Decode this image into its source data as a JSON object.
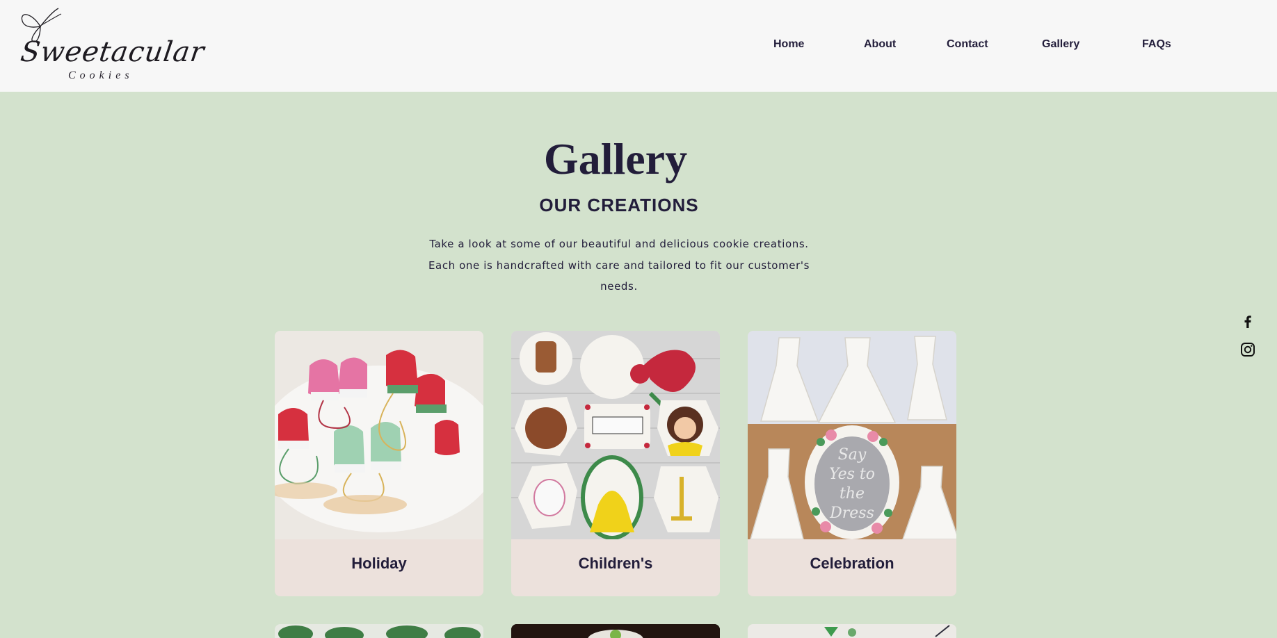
{
  "brand": {
    "name": "Sweetacular",
    "tagline": "Cookies"
  },
  "nav": {
    "items": [
      {
        "label": "Home"
      },
      {
        "label": "About"
      },
      {
        "label": "Contact"
      },
      {
        "label": "Gallery"
      },
      {
        "label": "FAQs"
      }
    ]
  },
  "hero": {
    "title": "Gallery",
    "subtitle": "OUR CREATIONS",
    "intro": "Take a look at some of our beautiful and delicious cookie creations. Each one is handcrafted with care and tailored to fit our customer's needs."
  },
  "social": [
    {
      "icon": "facebook-icon"
    },
    {
      "icon": "instagram-icon"
    }
  ],
  "gallery": {
    "cards": [
      {
        "label": "Holiday"
      },
      {
        "label": "Children's"
      },
      {
        "label": "Celebration"
      }
    ]
  },
  "colors": {
    "background": "#d3e2cd",
    "header": "#f7f7f7",
    "card": "#ece1dc",
    "text": "#221d3a"
  }
}
